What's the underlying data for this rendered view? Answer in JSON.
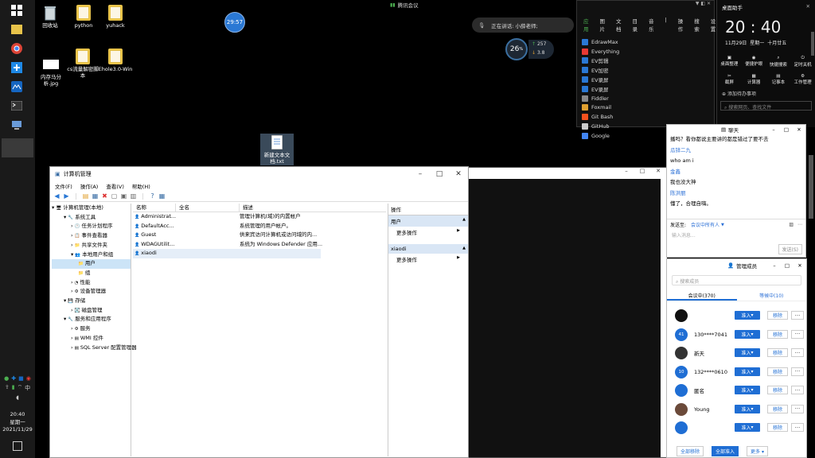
{
  "taskbar": {
    "time": "20:40",
    "weekday": "星期一",
    "date": "2021/11/29"
  },
  "desktop": {
    "icons": [
      {
        "label": "回收站",
        "icon": "recycle-bin-icon"
      },
      {
        "label": "python",
        "icon": "folder-icon"
      },
      {
        "label": "yuhack",
        "icon": "folder-icon"
      },
      {
        "label": "内存马分析.jpg",
        "icon": "image-file-icon"
      },
      {
        "label": "cs流量解密脚本",
        "icon": "folder-icon"
      },
      {
        "label": "Ehole3.0-Win",
        "icon": "folder-icon"
      },
      {
        "label": "新建文本文档.txt",
        "icon": "text-file-icon"
      }
    ],
    "timer_badge": "29:57",
    "meeting_label": "腾讯会议",
    "speaking_text": "正在讲话: 小薛老师;",
    "net_percent": "26",
    "net_percent_unit": "%",
    "net_up": "257",
    "net_down": "3.8"
  },
  "apps_panel": {
    "tabs": [
      "应用",
      "图片",
      "文档",
      "目录",
      "音乐",
      "|",
      "操作",
      "搜索",
      "设置"
    ],
    "items": [
      "EdrawMax",
      "Everything",
      "EV剪辑",
      "EV加密",
      "EV录屏",
      "EV录屏",
      "Fiddler",
      "Foxmail",
      "Git Bash",
      "GitHub",
      "Google"
    ]
  },
  "clock_panel": {
    "title": "桌面助手",
    "time": "20 : 40",
    "date": "11月29日",
    "weekday": "星期一",
    "lunar": "十月廿五",
    "tools": [
      "桌面整理",
      "便捷护眼",
      "快捷搜索",
      "定时关机",
      "截屏",
      "计算器",
      "记事本",
      "工作管理"
    ],
    "add_label": "添加待办事项",
    "search_placeholder": "搜索网页、查找文件"
  },
  "mmc": {
    "title": "计算机管理",
    "menu": [
      "文件(F)",
      "操作(A)",
      "查看(V)",
      "帮助(H)"
    ],
    "tree": [
      {
        "label": "计算机管理(本地)",
        "indent": 0
      },
      {
        "label": "系统工具",
        "indent": 1
      },
      {
        "label": "任务计划程序",
        "indent": 2
      },
      {
        "label": "事件查看器",
        "indent": 2
      },
      {
        "label": "共享文件夹",
        "indent": 2
      },
      {
        "label": "本地用户和组",
        "indent": 2
      },
      {
        "label": "用户",
        "indent": 3
      },
      {
        "label": "组",
        "indent": 3
      },
      {
        "label": "性能",
        "indent": 2
      },
      {
        "label": "设备管理器",
        "indent": 2
      },
      {
        "label": "存储",
        "indent": 1
      },
      {
        "label": "磁盘管理",
        "indent": 2
      },
      {
        "label": "服务和应用程序",
        "indent": 1
      },
      {
        "label": "服务",
        "indent": 2
      },
      {
        "label": "WMI 控件",
        "indent": 2
      },
      {
        "label": "SQL Server 配置管理器",
        "indent": 2
      }
    ],
    "columns": [
      "名称",
      "全名",
      "描述"
    ],
    "rows": [
      {
        "name": "Administrat...",
        "full": "",
        "desc": "管理计算机(域)的内置帐户"
      },
      {
        "name": "DefaultAcc...",
        "full": "",
        "desc": "系统管理的用户帐户。"
      },
      {
        "name": "Guest",
        "full": "",
        "desc": "供来宾访问计算机或访问域的内..."
      },
      {
        "name": "WDAGUtilit...",
        "full": "",
        "desc": "系统为 Windows Defender 应用..."
      },
      {
        "name": "xiaodi",
        "full": "",
        "desc": ""
      }
    ],
    "actions": {
      "header": "操作",
      "sec1": "用户",
      "more1": "更多操作",
      "sec2": "xiaodi",
      "more2": "更多操作"
    }
  },
  "chat": {
    "title": "聊天",
    "messages": [
      {
        "text": "播吗？看你都说主要讲的都是错过了要不去",
        "type": "text"
      },
      {
        "text": "瓜锌二九",
        "type": "name"
      },
      {
        "text": "who am i",
        "type": "text"
      },
      {
        "text": "金鑫",
        "type": "name"
      },
      {
        "text": "我也没大神",
        "type": "text"
      },
      {
        "text": "陈洪丽",
        "type": "name"
      },
      {
        "text": "懂了，合理自嗨。",
        "type": "text"
      }
    ],
    "send_to_label": "发送至:",
    "send_to_value": "会议中所有人",
    "input_placeholder": "输入消息...",
    "send_button": "发送(S)"
  },
  "members": {
    "title": "管理成员",
    "search_placeholder": "搜索成员",
    "tab_in": "会议中(370)",
    "tab_wait": "等候中(10)",
    "rows": [
      {
        "name": "",
        "avatar": "",
        "color": "#111111"
      },
      {
        "name": "130****7041",
        "avatar": "41",
        "color": "#1f6ed4"
      },
      {
        "name": "新天",
        "avatar": "",
        "color": "#333333"
      },
      {
        "name": "132****0610",
        "avatar": "10",
        "color": "#1f6ed4"
      },
      {
        "name": "匿名",
        "avatar": "",
        "color": "#1f6ed4"
      },
      {
        "name": "Young",
        "avatar": "",
        "color": "#6b4a3a"
      },
      {
        "name": "",
        "avatar": "",
        "color": "#1f6ed4"
      }
    ],
    "admit_label": "准入",
    "remove_label": "移除",
    "footer": {
      "remove_all": "全部移除",
      "admit_all": "全部准入",
      "more": "更多"
    }
  },
  "colors": {
    "accent": "#1f6ed4",
    "taskbar": "#1a1a1a"
  }
}
